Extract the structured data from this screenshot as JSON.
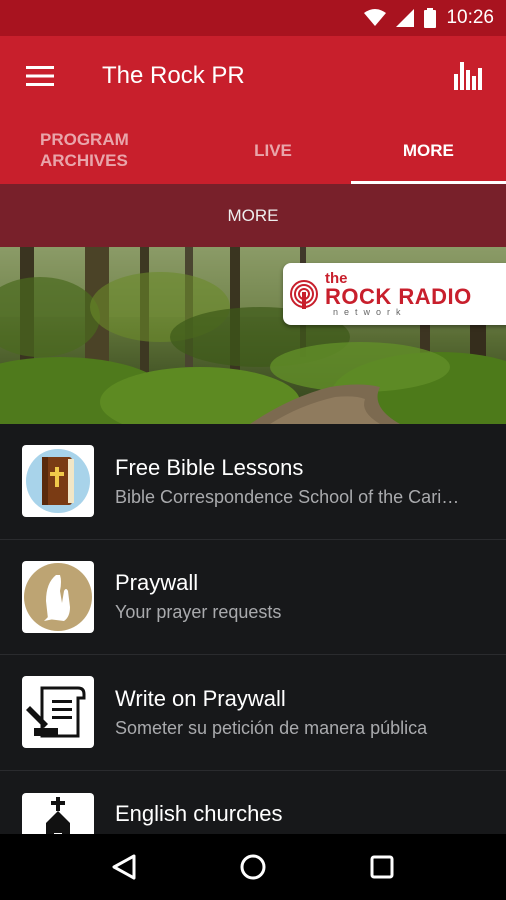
{
  "status": {
    "time": "10:26"
  },
  "app_bar": {
    "title": "The Rock PR"
  },
  "tabs": [
    {
      "label": "PROGRAM ARCHIVES",
      "active": false
    },
    {
      "label": "LIVE",
      "active": false
    },
    {
      "label": "MORE",
      "active": true
    }
  ],
  "sub_header": {
    "label": "MORE"
  },
  "banner": {
    "logo": {
      "the": "the",
      "main": "ROCK RADIO",
      "sub": "network"
    }
  },
  "items": [
    {
      "title": "Free Bible Lessons",
      "subtitle": "Bible Correspondence School of the Cari…",
      "icon": "bible-icon"
    },
    {
      "title": "Praywall",
      "subtitle": "Your prayer requests",
      "icon": "praying-hands-icon"
    },
    {
      "title": "Write on Praywall",
      "subtitle": "Someter su petición de manera pública",
      "icon": "write-scroll-icon"
    },
    {
      "title": "English churches",
      "subtitle": "",
      "icon": "church-icon"
    }
  ],
  "colors": {
    "primary": "#c81f2c",
    "status_bar": "#a8131f",
    "sub_header": "#78202a",
    "background": "#17181a"
  }
}
